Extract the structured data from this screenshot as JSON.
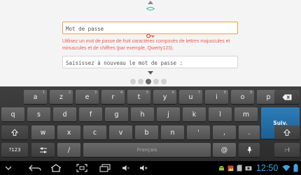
{
  "form": {
    "password_value": "Mot de passe",
    "hint": "Utilisez un mot de passe de huit caractères composés de lettres majuscules et minuscules et de chiffres (par exemple, Qwerty123).",
    "confirm_value": "Saisissez à nouveau le mot de passe :"
  },
  "pager": {
    "total": 5,
    "active": 2
  },
  "keyboard": {
    "row1": [
      {
        "label": "a",
        "alt": "1"
      },
      {
        "label": "z",
        "alt": "2"
      },
      {
        "label": "e",
        "alt": "3"
      },
      {
        "label": "r",
        "alt": "4"
      },
      {
        "label": "t",
        "alt": "5"
      },
      {
        "label": "y",
        "alt": "6"
      },
      {
        "label": "u",
        "alt": "7"
      },
      {
        "label": "i",
        "alt": "8"
      },
      {
        "label": "o",
        "alt": "9"
      },
      {
        "label": "p",
        "alt": "0"
      }
    ],
    "row2": [
      "q",
      "s",
      "d",
      "f",
      "g",
      "h",
      "j",
      "k",
      "l",
      "m"
    ],
    "row3": [
      "w",
      "x",
      "c",
      "v",
      "b",
      "n",
      "'",
      ",",
      "."
    ],
    "numbers_label": "?123",
    "space_label": "Français",
    "next_label": "Suiv.",
    "smiley_label": ":-)"
  },
  "statusbar": {
    "time": "12:50"
  },
  "colors": {
    "focus_border": "#f2a03a",
    "hint_text": "#ef5b5b",
    "next_key": "#1a5f95",
    "clock": "#39a6e0"
  },
  "icons": {
    "backspace": "backspace-icon",
    "shift": "shift-icon",
    "settings": "settings-icon",
    "mic": "microphone-icon",
    "back": "back-icon",
    "home": "home-icon",
    "recents": "recent-apps-icon",
    "screenshot": "screenshot-icon"
  }
}
